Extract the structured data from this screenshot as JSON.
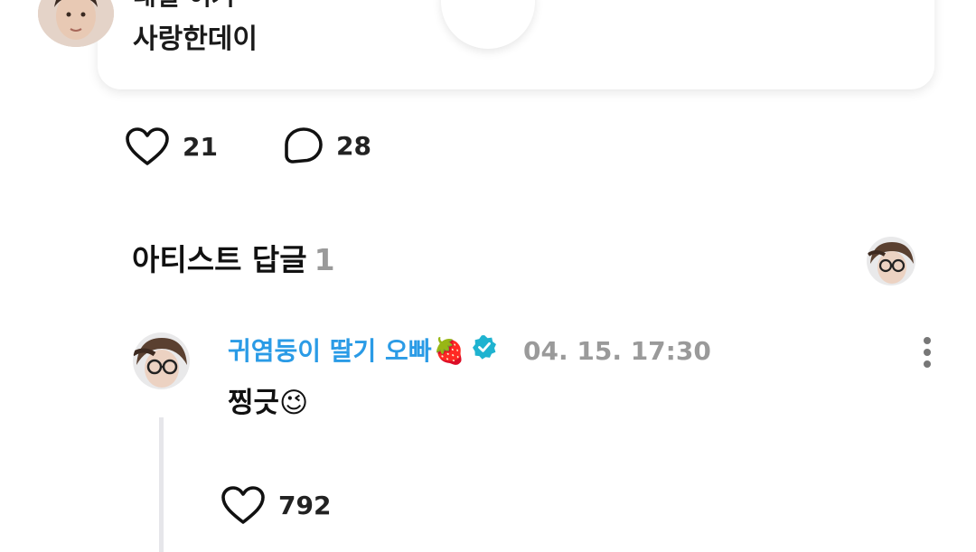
{
  "post": {
    "author_partial": "대일 이거",
    "text": "사랑한데이"
  },
  "reactions": {
    "likes": "21",
    "comments": "28"
  },
  "section": {
    "title": "아티스트 답글",
    "count": "1"
  },
  "artist_comment": {
    "author": "귀염둥이 딸기 오빠",
    "author_emoji": "🍓",
    "timestamp": "04. 15. 17:30",
    "text": "찡긋",
    "text_emoji": "😉",
    "likes": "792"
  },
  "icons": {
    "like": "heart-icon",
    "comment": "speech-bubble-icon",
    "verified": "verified-badge-icon",
    "more": "more-vertical-icon"
  },
  "colors": {
    "author_name": "#2a9be6",
    "verified_badge": "#1fb3d0",
    "muted": "#9a9a9a"
  }
}
